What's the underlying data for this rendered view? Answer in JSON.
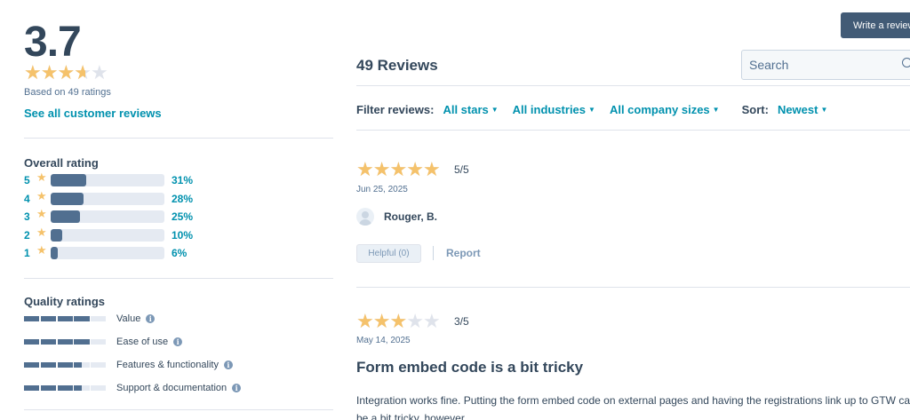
{
  "summary": {
    "score": "3.7",
    "score_value": 3.7,
    "based_on": "Based on 49 ratings",
    "see_all_label": "See all customer reviews"
  },
  "overall": {
    "title": "Overall rating",
    "rows": [
      {
        "stars": "5",
        "percent": "31%",
        "value": 31
      },
      {
        "stars": "4",
        "percent": "28%",
        "value": 28
      },
      {
        "stars": "3",
        "percent": "25%",
        "value": 25
      },
      {
        "stars": "2",
        "percent": "10%",
        "value": 10
      },
      {
        "stars": "1",
        "percent": "6%",
        "value": 6
      }
    ]
  },
  "quality": {
    "title": "Quality ratings",
    "rows": [
      {
        "label": "Value",
        "score": 4.0
      },
      {
        "label": "Ease of use",
        "score": 4.0
      },
      {
        "label": "Features & functionality",
        "score": 3.5
      },
      {
        "label": "Support & documentation",
        "score": 3.5
      }
    ]
  },
  "header": {
    "write_review_label": "Write a review",
    "reviews_count": "49 Reviews",
    "search_placeholder": "Search"
  },
  "filters": {
    "label": "Filter reviews:",
    "stars": "All stars",
    "industries": "All industries",
    "company_sizes": "All company sizes",
    "sort_label": "Sort:",
    "sort_value": "Newest"
  },
  "reviews": [
    {
      "rating": 5,
      "score": "5/5",
      "date": "Jun 25, 2025",
      "reviewer": "Rouger, B.",
      "helpful_label": "Helpful (0)",
      "report_label": "Report"
    },
    {
      "rating": 3,
      "score": "3/5",
      "date": "May 14, 2025",
      "title": "Form embed code is a bit tricky",
      "body": "Integration works fine. Putting the form embed code on external pages and having the registrations link up to GTW can be a bit tricky, however."
    }
  ],
  "colors": {
    "star": "#f5c26b",
    "star_empty": "#dfe3eb",
    "accent": "#0091ae",
    "bar": "#516f90",
    "button": "#425b76"
  }
}
